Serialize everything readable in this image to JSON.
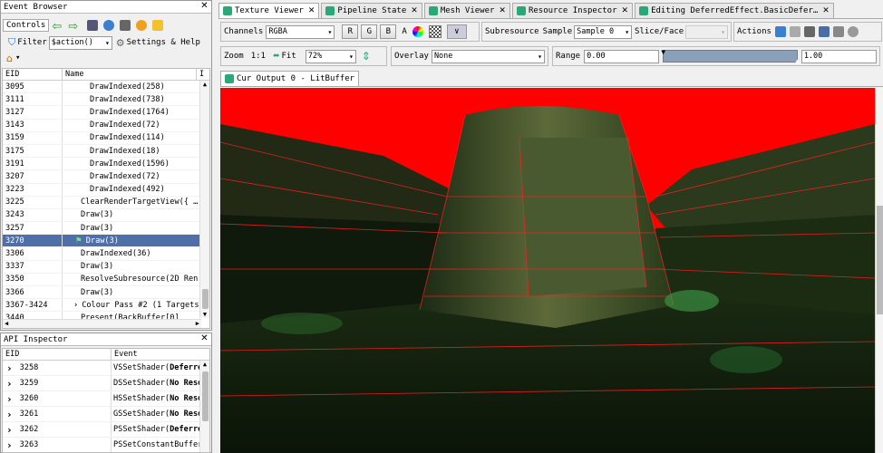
{
  "event_browser": {
    "title": "Event Browser",
    "controls_label": "Controls",
    "filter_label": "Filter",
    "filter_value": "$action()",
    "settings_label": "Settings & Help",
    "col_eid": "EID",
    "col_name": "Name",
    "col_extra": "I",
    "rows": [
      {
        "eid": "3095",
        "name": "DrawIndexed(258)"
      },
      {
        "eid": "3111",
        "name": "DrawIndexed(738)"
      },
      {
        "eid": "3127",
        "name": "DrawIndexed(1764)"
      },
      {
        "eid": "3143",
        "name": "DrawIndexed(72)"
      },
      {
        "eid": "3159",
        "name": "DrawIndexed(114)"
      },
      {
        "eid": "3175",
        "name": "DrawIndexed(18)"
      },
      {
        "eid": "3191",
        "name": "DrawIndexed(1596)"
      },
      {
        "eid": "3207",
        "name": "DrawIndexed(72)"
      },
      {
        "eid": "3223",
        "name": "DrawIndexed(492)"
      },
      {
        "eid": "3225",
        "name": "ClearRenderTargetView({ …"
      },
      {
        "eid": "3243",
        "name": "Draw(3)"
      },
      {
        "eid": "3257",
        "name": "Draw(3)"
      },
      {
        "eid": "3270",
        "name": "Draw(3)"
      },
      {
        "eid": "3306",
        "name": "DrawIndexed(36)"
      },
      {
        "eid": "3337",
        "name": "Draw(3)"
      },
      {
        "eid": "3350",
        "name": "ResolveSubresource(2D Ren"
      },
      {
        "eid": "3366",
        "name": "Draw(3)"
      },
      {
        "eid": "3367-3424",
        "name": "Colour Pass #2 (1 Targets)"
      },
      {
        "eid": "3440",
        "name": "Present(BackBuffer[0]"
      }
    ]
  },
  "api_inspector": {
    "title": "API Inspector",
    "col_eid": "EID",
    "col_event": "Event",
    "rows": [
      {
        "eid": "3258",
        "fn": "VSSetShader(",
        "arg": "Deferre"
      },
      {
        "eid": "3259",
        "fn": "DSSetShader(",
        "arg": "No Reso"
      },
      {
        "eid": "3260",
        "fn": "HSSetShader(",
        "arg": "No Reso"
      },
      {
        "eid": "3261",
        "fn": "GSSetShader(",
        "arg": "No Reso"
      },
      {
        "eid": "3262",
        "fn": "PSSetShader(",
        "arg": "Deferre"
      },
      {
        "eid": "3263",
        "fn": "PSSetConstantBuffers",
        "arg": ""
      }
    ]
  },
  "tabs": [
    {
      "label": "Texture Viewer",
      "active": true
    },
    {
      "label": "Pipeline State",
      "active": false
    },
    {
      "label": "Mesh Viewer",
      "active": false
    },
    {
      "label": "Resource Inspector",
      "active": false
    },
    {
      "label": "Editing DeferredEffect.BasicDefer…",
      "active": false
    }
  ],
  "toolbar": {
    "channels_label": "Channels",
    "channels_value": "RGBA",
    "r": "R",
    "g": "G",
    "b": "B",
    "a": "A",
    "subresource_label": "Subresource",
    "sample_label": "Sample",
    "sample_value": "Sample 0",
    "slice_face_label": "Slice/Face",
    "actions_label": "Actions",
    "zoom_label": "Zoom",
    "zoom_one": "1:1",
    "fit_label": "Fit",
    "zoom_value": "72%",
    "overlay_label": "Overlay",
    "overlay_value": "None",
    "range_label": "Range",
    "range_min": "0.00",
    "range_max": "1.00"
  },
  "output_tab": "Cur Output 0 - LitBuffer",
  "colors": {
    "selection": "#4f6fa8",
    "viewer_bg": "#ff0000",
    "accent_tab": "#2aa876"
  }
}
